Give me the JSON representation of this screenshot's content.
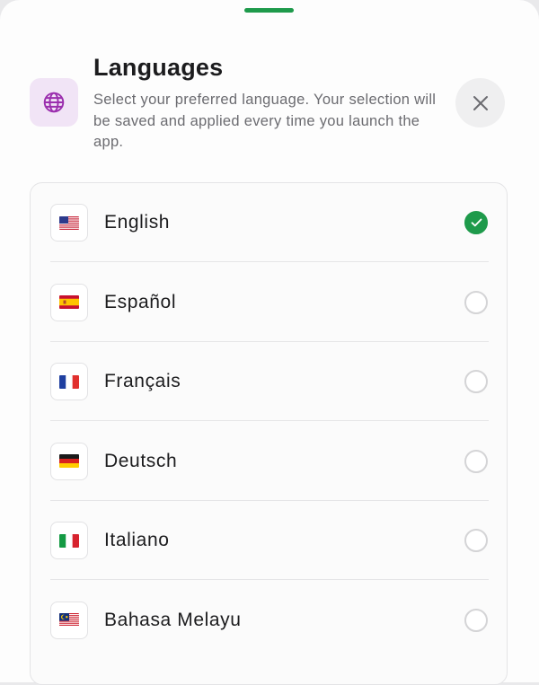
{
  "colors": {
    "accent": "#1e9a4b",
    "icon_purple": "#9b2fae",
    "icon_bg": "#f1e4f6"
  },
  "header": {
    "icon": "globe-icon",
    "title": "Languages",
    "subtitle": "Select your preferred language. Your selection will be saved and applied every time you launch the app.",
    "close_icon": "close-icon"
  },
  "languages": [
    {
      "label": "English",
      "flag": "us-flag-icon",
      "selected": true
    },
    {
      "label": "Español",
      "flag": "spain-flag-icon",
      "selected": false
    },
    {
      "label": "Français",
      "flag": "france-flag-icon",
      "selected": false
    },
    {
      "label": "Deutsch",
      "flag": "germany-flag-icon",
      "selected": false
    },
    {
      "label": "Italiano",
      "flag": "italy-flag-icon",
      "selected": false
    },
    {
      "label": "Bahasa Melayu",
      "flag": "malaysia-flag-icon",
      "selected": false
    }
  ]
}
